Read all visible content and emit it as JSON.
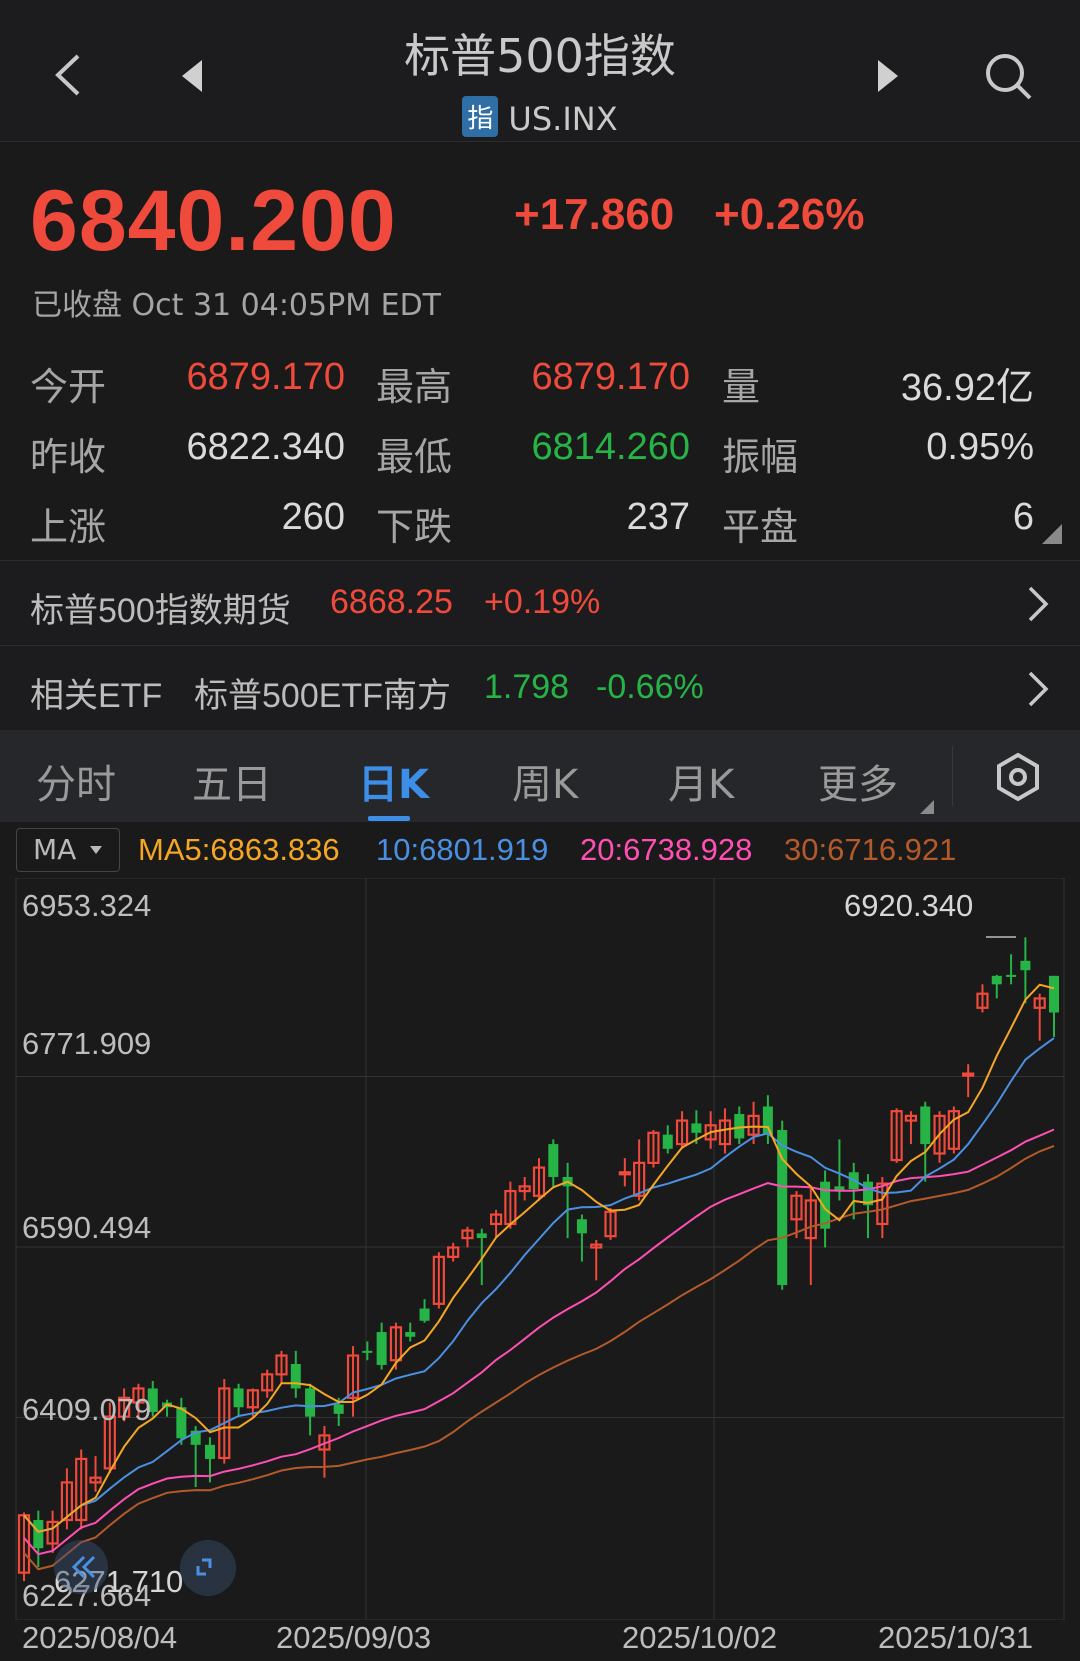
{
  "header": {
    "title": "标普500指数",
    "badge": "指",
    "symbol": "US.INX",
    "icons": [
      "back-chevron-icon",
      "prev-triangle-icon",
      "next-triangle-icon",
      "search-icon"
    ]
  },
  "quote": {
    "price": "6840.200",
    "change": "+17.860",
    "change_pct": "+0.26%",
    "status": "已收盘 Oct 31 04:05PM EDT",
    "stats": [
      {
        "label": "今开",
        "value": "6879.170",
        "color": "red"
      },
      {
        "label": "最高",
        "value": "6879.170",
        "color": "red"
      },
      {
        "label": "量",
        "value": "36.92亿",
        "color": "white"
      },
      {
        "label": "昨收",
        "value": "6822.340",
        "color": "white"
      },
      {
        "label": "最低",
        "value": "6814.260",
        "color": "green"
      },
      {
        "label": "振幅",
        "value": "0.95%",
        "color": "white"
      },
      {
        "label": "上涨",
        "value": "260",
        "color": "white"
      },
      {
        "label": "下跌",
        "value": "237",
        "color": "white"
      },
      {
        "label": "平盘",
        "value": "6",
        "color": "white"
      }
    ]
  },
  "futures": {
    "label": "标普500指数期货",
    "price": "6868.25",
    "pct": "+0.19%"
  },
  "etf": {
    "label": "相关ETF",
    "name": "标普500ETF南方",
    "price": "1.798",
    "pct": "-0.66%"
  },
  "tabs": [
    "分时",
    "五日",
    "日K",
    "周K",
    "月K",
    "更多"
  ],
  "active_tab": "日K",
  "ma": {
    "selector": "MA",
    "ma5": "MA5:6863.836",
    "ma10": "10:6801.919",
    "ma20": "20:6738.928",
    "ma30": "30:6716.921"
  },
  "colors": {
    "up": "#ef4a3b",
    "down": "#27b447",
    "ma5": "#f5a623",
    "ma10": "#4a90e2",
    "ma20": "#ff4fb4",
    "ma30": "#b35a2a",
    "accent": "#3d8ee6"
  },
  "chart_data": {
    "type": "candlestick",
    "ylim": [
      6227.664,
      6953.324
    ],
    "y_ticks": [
      "6953.324",
      "6771.909",
      "6590.494",
      "6409.079",
      "6227.664"
    ],
    "x_ticks": [
      "2025/08/04",
      "2025/09/03",
      "2025/10/02",
      "2025/10/31"
    ],
    "max_label": "6920.340",
    "min_label": "6271.710",
    "grid": true,
    "candles": [
      {
        "o": 6244,
        "h": 6308,
        "l": 6235,
        "c": 6305
      },
      {
        "o": 6300,
        "h": 6310,
        "l": 6250,
        "c": 6270
      },
      {
        "o": 6275,
        "h": 6310,
        "l": 6265,
        "c": 6298
      },
      {
        "o": 6300,
        "h": 6355,
        "l": 6290,
        "c": 6340
      },
      {
        "o": 6300,
        "h": 6375,
        "l": 6290,
        "c": 6365
      },
      {
        "o": 6340,
        "h": 6368,
        "l": 6330,
        "c": 6345
      },
      {
        "o": 6355,
        "h": 6425,
        "l": 6350,
        "c": 6410
      },
      {
        "o": 6410,
        "h": 6440,
        "l": 6405,
        "c": 6430
      },
      {
        "o": 6425,
        "h": 6445,
        "l": 6410,
        "c": 6440
      },
      {
        "o": 6440,
        "h": 6448,
        "l": 6410,
        "c": 6415
      },
      {
        "o": 6425,
        "h": 6428,
        "l": 6410,
        "c": 6420
      },
      {
        "o": 6420,
        "h": 6430,
        "l": 6380,
        "c": 6387
      },
      {
        "o": 6395,
        "h": 6400,
        "l": 6335,
        "c": 6380
      },
      {
        "o": 6380,
        "h": 6388,
        "l": 6340,
        "c": 6365
      },
      {
        "o": 6366,
        "h": 6450,
        "l": 6360,
        "c": 6440
      },
      {
        "o": 6440,
        "h": 6445,
        "l": 6410,
        "c": 6420
      },
      {
        "o": 6420,
        "h": 6440,
        "l": 6410,
        "c": 6438
      },
      {
        "o": 6438,
        "h": 6460,
        "l": 6430,
        "c": 6455
      },
      {
        "o": 6455,
        "h": 6480,
        "l": 6445,
        "c": 6475
      },
      {
        "o": 6466,
        "h": 6480,
        "l": 6430,
        "c": 6440
      },
      {
        "o": 6440,
        "h": 6445,
        "l": 6390,
        "c": 6410
      },
      {
        "o": 6375,
        "h": 6400,
        "l": 6345,
        "c": 6390
      },
      {
        "o": 6423,
        "h": 6430,
        "l": 6400,
        "c": 6413
      },
      {
        "o": 6430,
        "h": 6485,
        "l": 6410,
        "c": 6475
      },
      {
        "o": 6480,
        "h": 6490,
        "l": 6470,
        "c": 6478
      },
      {
        "o": 6500,
        "h": 6510,
        "l": 6460,
        "c": 6465
      },
      {
        "o": 6470,
        "h": 6510,
        "l": 6460,
        "c": 6505
      },
      {
        "o": 6500,
        "h": 6510,
        "l": 6490,
        "c": 6495
      },
      {
        "o": 6525,
        "h": 6535,
        "l": 6510,
        "c": 6512
      },
      {
        "o": 6530,
        "h": 6585,
        "l": 6525,
        "c": 6580
      },
      {
        "o": 6580,
        "h": 6595,
        "l": 6575,
        "c": 6590
      },
      {
        "o": 6600,
        "h": 6612,
        "l": 6590,
        "c": 6608
      },
      {
        "o": 6605,
        "h": 6610,
        "l": 6550,
        "c": 6600
      },
      {
        "o": 6615,
        "h": 6630,
        "l": 6600,
        "c": 6625
      },
      {
        "o": 6615,
        "h": 6660,
        "l": 6610,
        "c": 6650
      },
      {
        "o": 6650,
        "h": 6665,
        "l": 6640,
        "c": 6655
      },
      {
        "o": 6645,
        "h": 6685,
        "l": 6640,
        "c": 6675
      },
      {
        "o": 6700,
        "h": 6705,
        "l": 6655,
        "c": 6665
      },
      {
        "o": 6665,
        "h": 6680,
        "l": 6600,
        "c": 6655
      },
      {
        "o": 6620,
        "h": 6625,
        "l": 6575,
        "c": 6605
      },
      {
        "o": 6590,
        "h": 6598,
        "l": 6555,
        "c": 6593
      },
      {
        "o": 6602,
        "h": 6632,
        "l": 6598,
        "c": 6628
      },
      {
        "o": 6668,
        "h": 6685,
        "l": 6655,
        "c": 6670
      },
      {
        "o": 6645,
        "h": 6705,
        "l": 6640,
        "c": 6680
      },
      {
        "o": 6680,
        "h": 6715,
        "l": 6675,
        "c": 6712
      },
      {
        "o": 6710,
        "h": 6720,
        "l": 6690,
        "c": 6695
      },
      {
        "o": 6700,
        "h": 6735,
        "l": 6695,
        "c": 6725
      },
      {
        "o": 6722,
        "h": 6736,
        "l": 6700,
        "c": 6712
      },
      {
        "o": 6705,
        "h": 6735,
        "l": 6695,
        "c": 6720
      },
      {
        "o": 6700,
        "h": 6738,
        "l": 6690,
        "c": 6725
      },
      {
        "o": 6732,
        "h": 6740,
        "l": 6700,
        "c": 6706
      },
      {
        "o": 6710,
        "h": 6745,
        "l": 6700,
        "c": 6730
      },
      {
        "o": 6740,
        "h": 6752,
        "l": 6700,
        "c": 6710
      },
      {
        "o": 6715,
        "h": 6725,
        "l": 6545,
        "c": 6550
      },
      {
        "o": 6620,
        "h": 6650,
        "l": 6600,
        "c": 6645
      },
      {
        "o": 6600,
        "h": 6655,
        "l": 6550,
        "c": 6640
      },
      {
        "o": 6660,
        "h": 6672,
        "l": 6590,
        "c": 6610
      },
      {
        "o": 6655,
        "h": 6705,
        "l": 6640,
        "c": 6650
      },
      {
        "o": 6670,
        "h": 6680,
        "l": 6620,
        "c": 6652
      },
      {
        "o": 6660,
        "h": 6668,
        "l": 6600,
        "c": 6635
      },
      {
        "o": 6615,
        "h": 6665,
        "l": 6600,
        "c": 6658
      },
      {
        "o": 6683,
        "h": 6738,
        "l": 6680,
        "c": 6735
      },
      {
        "o": 6725,
        "h": 6735,
        "l": 6700,
        "c": 6730
      },
      {
        "o": 6740,
        "h": 6745,
        "l": 6660,
        "c": 6700
      },
      {
        "o": 6690,
        "h": 6735,
        "l": 6680,
        "c": 6730
      },
      {
        "o": 6695,
        "h": 6740,
        "l": 6690,
        "c": 6735
      },
      {
        "o": 6773,
        "h": 6785,
        "l": 6750,
        "c": 6775
      },
      {
        "o": 6845,
        "h": 6870,
        "l": 6840,
        "c": 6860
      },
      {
        "o": 6879,
        "h": 6880,
        "l": 6855,
        "c": 6870
      },
      {
        "o": 6880,
        "h": 6902,
        "l": 6870,
        "c": 6878
      },
      {
        "o": 6895,
        "h": 6920,
        "l": 6850,
        "c": 6885
      },
      {
        "o": 6845,
        "h": 6860,
        "l": 6810,
        "c": 6855
      },
      {
        "o": 6879,
        "h": 6879,
        "l": 6814,
        "c": 6840
      }
    ]
  }
}
